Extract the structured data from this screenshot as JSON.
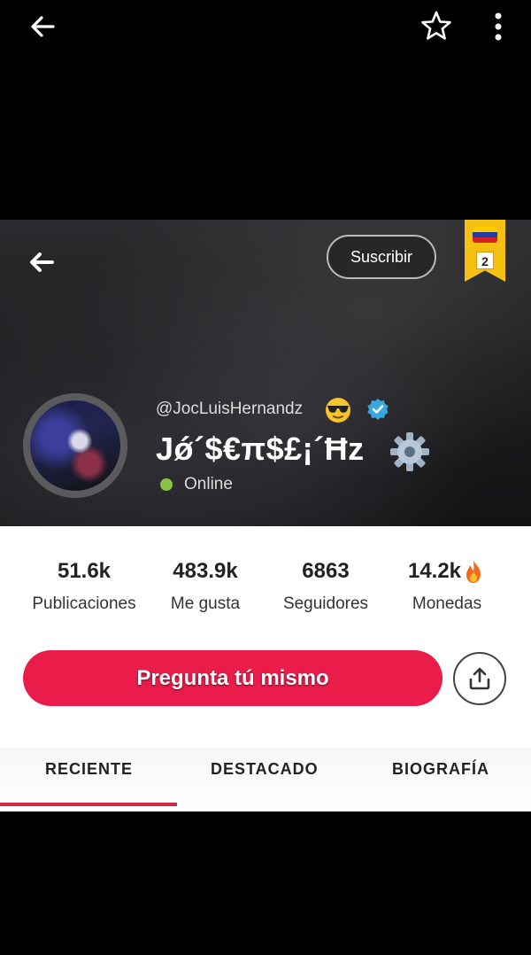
{
  "topbar": {
    "back_icon": "arrow-left-icon",
    "favorite_icon": "star-outline-icon",
    "more_icon": "more-vertical-icon"
  },
  "profile": {
    "back_icon": "arrow-left-icon",
    "subscribe_label": "Suscribir",
    "rank_badge": {
      "flag": "venezuela-flag-icon",
      "rank": "2",
      "color": "#f6c012"
    },
    "handle": "@JocLuisHernandz",
    "display_name": "Jǿ´$€π$£¡´Ħz",
    "status": "Online",
    "status_color": "#8bc34a"
  },
  "stats": [
    {
      "value": "51.6k",
      "label": "Publicaciones"
    },
    {
      "value": "483.9k",
      "label": "Me gusta"
    },
    {
      "value": "6863",
      "label": "Seguidores"
    },
    {
      "value": "14.2k",
      "label": "Monedas"
    }
  ],
  "actions": {
    "ask_label": "Pregunta tú mismo",
    "ask_color": "#ea1c4a",
    "share_icon": "share-upload-icon"
  },
  "tabs": [
    {
      "label": "RECIENTE",
      "active": true
    },
    {
      "label": "DESTACADO",
      "active": false
    },
    {
      "label": "BIOGRAFÍA",
      "active": false
    }
  ],
  "accent_color": "#d3283e"
}
